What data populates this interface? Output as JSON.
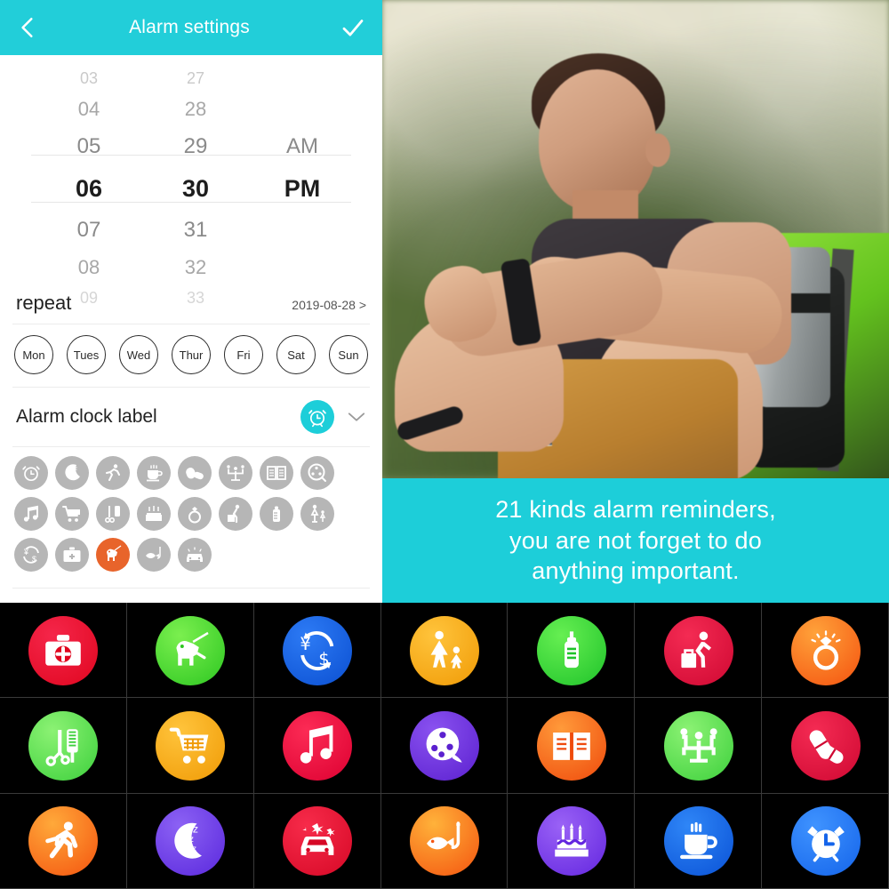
{
  "appbar": {
    "title": "Alarm settings",
    "back_icon": "chevron-left-icon",
    "confirm_icon": "check-icon"
  },
  "picker": {
    "hours": [
      "03",
      "04",
      "05",
      "06",
      "07",
      "08",
      "09"
    ],
    "minutes": [
      "27",
      "28",
      "29",
      "30",
      "31",
      "32",
      "33"
    ],
    "meridiem": [
      "",
      "",
      "AM",
      "PM",
      "",
      "",
      ""
    ],
    "selected_hour": "06",
    "selected_minute": "30",
    "selected_meridiem": "PM"
  },
  "repeat": {
    "label": "repeat",
    "date": "2019-08-28",
    "chevron": ">",
    "days": [
      "Mon",
      "Tues",
      "Wed",
      "Thur",
      "Fri",
      "Sat",
      "Sun"
    ]
  },
  "alarm_label": {
    "label": "Alarm clock label",
    "selected_icon": "alarm-clock-icon",
    "expand_icon": "chevron-down-icon"
  },
  "mini_icons": [
    {
      "name": "alarm-clock-icon",
      "selected": false
    },
    {
      "name": "sleep-moon-icon",
      "selected": false
    },
    {
      "name": "running-icon",
      "selected": false
    },
    {
      "name": "coffee-cup-icon",
      "selected": false
    },
    {
      "name": "pills-icon",
      "selected": false
    },
    {
      "name": "meeting-icon",
      "selected": false
    },
    {
      "name": "book-icon",
      "selected": false
    },
    {
      "name": "film-reel-icon",
      "selected": false
    },
    {
      "name": "music-note-icon",
      "selected": false
    },
    {
      "name": "shopping-cart-icon",
      "selected": false
    },
    {
      "name": "haircut-icon",
      "selected": false
    },
    {
      "name": "birthday-cake-icon",
      "selected": false
    },
    {
      "name": "ring-icon",
      "selected": false
    },
    {
      "name": "travel-luggage-icon",
      "selected": false
    },
    {
      "name": "baby-bottle-icon",
      "selected": false
    },
    {
      "name": "parent-child-icon",
      "selected": false
    },
    {
      "name": "money-exchange-icon",
      "selected": false
    },
    {
      "name": "first-aid-icon",
      "selected": false
    },
    {
      "name": "dog-walk-icon",
      "selected": true
    },
    {
      "name": "fishing-icon",
      "selected": false
    },
    {
      "name": "car-wash-icon",
      "selected": false
    }
  ],
  "photo": {
    "alt": "man sitting outdoors with green backpack looking at smartwatch"
  },
  "caption": {
    "line1": "21 kinds alarm reminders,",
    "line2": "you are not forget to do",
    "line3": "anything important."
  },
  "colors": {
    "accent_teal": "#1dced9",
    "appbar_teal": "#22ced9",
    "selected_orange": "#e8642b",
    "grid_background": "#000000"
  },
  "icon_grid": [
    {
      "name": "first-aid-icon",
      "color": "#e8102f"
    },
    {
      "name": "dog-walk-icon",
      "color": "#4dd830"
    },
    {
      "name": "money-exchange-icon",
      "color": "#1464e6"
    },
    {
      "name": "parent-child-icon",
      "color": "#f5a915"
    },
    {
      "name": "baby-bottle-icon",
      "color": "#3ed639"
    },
    {
      "name": "travel-luggage-icon",
      "color": "#e0123c"
    },
    {
      "name": "ring-icon",
      "color": "#f56a18"
    },
    {
      "name": "haircut-icon",
      "color": "#5fdc53"
    },
    {
      "name": "shopping-cart-icon",
      "color": "#f5a915"
    },
    {
      "name": "music-note-icon",
      "color": "#ec0f3d"
    },
    {
      "name": "film-reel-icon",
      "color": "#6a2fdb"
    },
    {
      "name": "book-icon",
      "color": "#f26715"
    },
    {
      "name": "meeting-icon",
      "color": "#5bdd4e"
    },
    {
      "name": "pills-icon",
      "color": "#e4123c"
    },
    {
      "name": "running-icon",
      "color": "#f87a12"
    },
    {
      "name": "sleep-moon-icon",
      "color": "#6f3ae4"
    },
    {
      "name": "car-wash-icon",
      "color": "#eb1334"
    },
    {
      "name": "fishing-icon",
      "color": "#f78e14"
    },
    {
      "name": "birthday-cake-icon",
      "color": "#7a3ae8"
    },
    {
      "name": "coffee-cup-icon",
      "color": "#1668ea"
    },
    {
      "name": "alarm-clock-icon",
      "color": "#2a7ef0"
    }
  ]
}
